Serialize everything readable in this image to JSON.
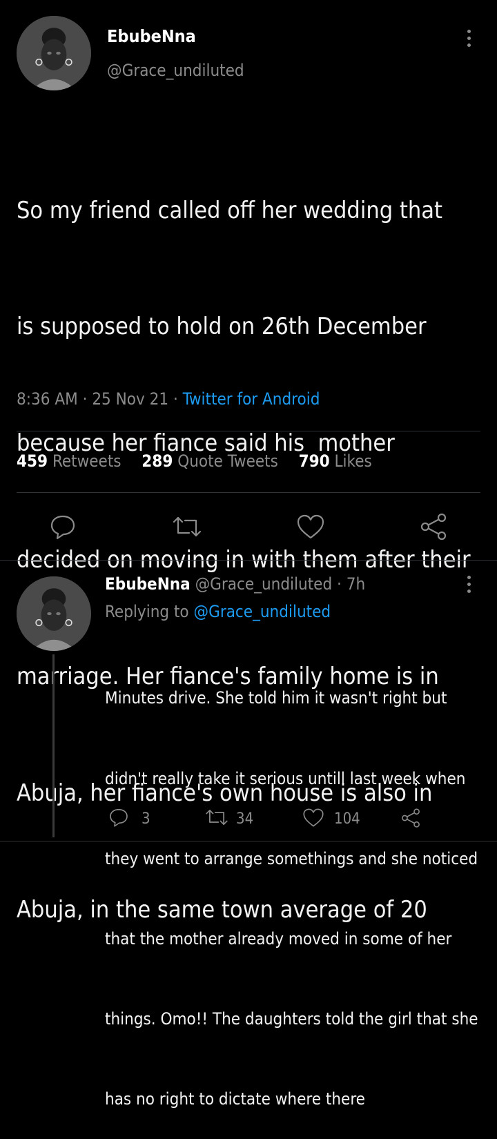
{
  "main_tweet": {
    "display_name": "EbubeNna",
    "handle": "@Grace_undiluted",
    "text_lines": [
      "So my friend called off her wedding that",
      "is supposed to hold on 26th December",
      "because her fiance said his  mother",
      "decided on moving in with them after their",
      "marriage. Her fiance's family home is in",
      "Abuja, her fiance's own house is also in",
      "Abuja, in the same town average of 20"
    ],
    "time": "8:36 AM",
    "date": "25 Nov 21",
    "source": "Twitter for Android",
    "sep": "·",
    "stats": {
      "retweets": "459",
      "retweets_label": "Retweets",
      "quotes": "289",
      "quotes_label": "Quote Tweets",
      "likes": "790",
      "likes_label": "Likes"
    }
  },
  "reply": {
    "display_name": "EbubeNna",
    "handle": "@Grace_undiluted",
    "time_ago": "· 7h",
    "replying_prefix": "Replying to",
    "replying_to": "@Grace_undiluted",
    "text_lines": [
      "Minutes drive. She told him it wasn't right but",
      "didn't really take it serious untill last week when",
      "they went to arrange somethings and she noticed",
      "that the mother already moved in some of her",
      "things. Omo!! The daughters told the girl that she",
      "has no right to dictate where there"
    ],
    "counts": {
      "replies": "3",
      "retweets": "34",
      "likes": "104"
    }
  },
  "icons": {
    "reply": "reply-icon",
    "retweet": "retweet-icon",
    "like": "heart-icon",
    "share": "share-icon",
    "more": "more-options-icon"
  },
  "colors": {
    "background": "#000000",
    "link": "#1d9bf0",
    "muted": "#8b8b8b",
    "text": "#e7e9ea"
  }
}
